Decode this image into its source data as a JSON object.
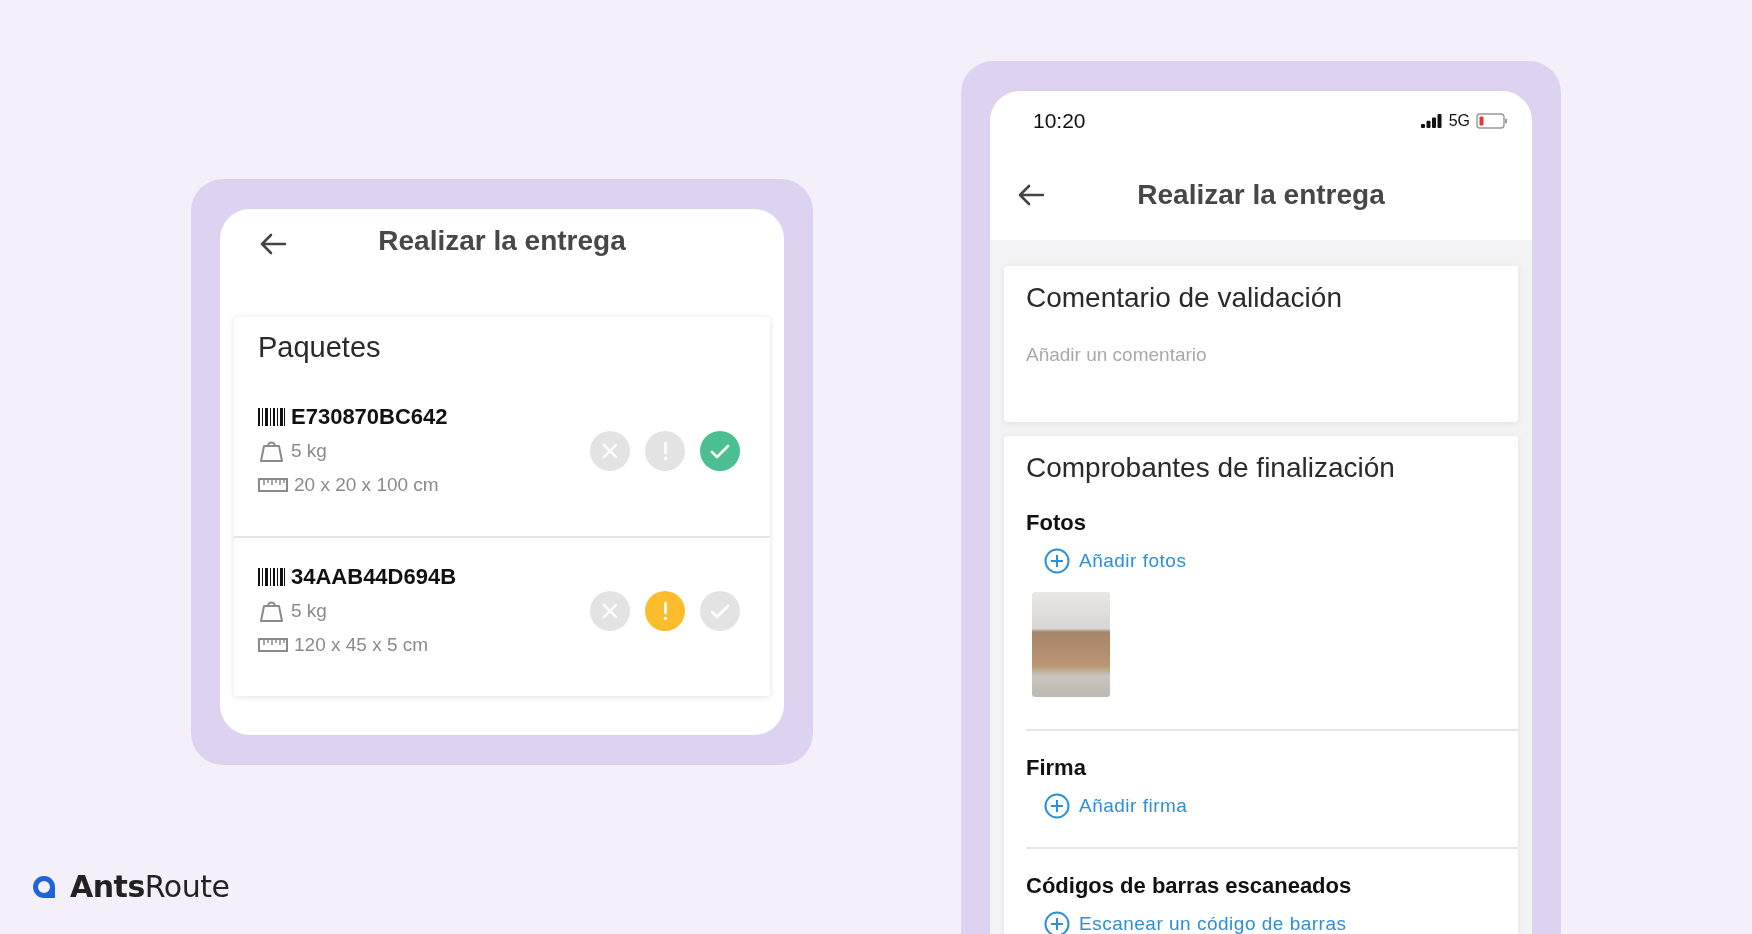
{
  "left_screen": {
    "header": {
      "title": "Realizar la entrega"
    },
    "packages_card": {
      "title": "Paquetes",
      "packages": [
        {
          "code": "E730870BC642",
          "weight": "5 kg",
          "dimensions": "20 x 20 x 100 cm",
          "actions": [
            {
              "kind": "reject",
              "selected": false
            },
            {
              "kind": "issue",
              "selected": false
            },
            {
              "kind": "confirm",
              "selected": true
            }
          ]
        },
        {
          "code": "34AAB44D694B",
          "weight": "5 kg",
          "dimensions": "120 x 45 x 5 cm",
          "actions": [
            {
              "kind": "reject",
              "selected": false
            },
            {
              "kind": "issue",
              "selected": true
            },
            {
              "kind": "confirm",
              "selected": false
            }
          ]
        }
      ]
    }
  },
  "right_screen": {
    "status_bar": {
      "time": "10:20",
      "network": "5G"
    },
    "header": {
      "title": "Realizar la entrega"
    },
    "comment_card": {
      "title": "Comentario de validación",
      "placeholder": "Añadir un comentario"
    },
    "proofs_card": {
      "title": "Comprobantes de finalización",
      "sections": [
        {
          "title": "Fotos",
          "action": "Añadir fotos",
          "photos": [
            {
              "kind": "photo"
            }
          ]
        },
        {
          "title": "Firma",
          "action": "Añadir firma"
        },
        {
          "title": "Códigos de barras escaneados",
          "action": "Escanear un código de barras"
        }
      ]
    }
  },
  "brand": {
    "name": "**Ants**Route"
  }
}
